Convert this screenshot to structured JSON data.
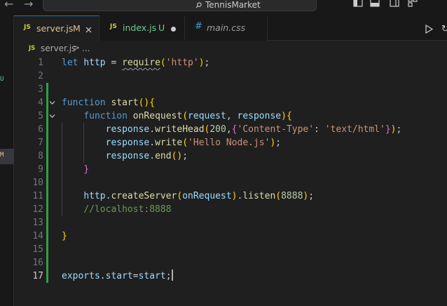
{
  "titlebar": {
    "search_title": "TennisMarket",
    "back_icon": "arrow-left-icon",
    "forward_icon": "arrow-right-icon"
  },
  "activitybar": {
    "badge_u": "U",
    "badge_m": "M"
  },
  "tabs": [
    {
      "icon": "JS",
      "name": "server.js",
      "status": "M",
      "active": true,
      "has_close": true
    },
    {
      "icon": "JS",
      "name": "index.js",
      "status": "U",
      "active": false,
      "has_dot": true
    },
    {
      "icon": "#",
      "name": "main.css",
      "status": "",
      "active": false,
      "italic": true
    }
  ],
  "breadcrumb": {
    "icon": "JS",
    "file": "server.js",
    "separator": ">",
    "more": "..."
  },
  "editor": {
    "current_line": 17,
    "lines": [
      {
        "n": "1",
        "text": "let http = require('http');"
      },
      {
        "n": "2",
        "text": ""
      },
      {
        "n": "3",
        "text": ""
      },
      {
        "n": "4",
        "text": "function start(){"
      },
      {
        "n": "5",
        "text": "    function onRequest(request, response){"
      },
      {
        "n": "6",
        "text": "        response.writeHead(200,{'Content-Type': 'text/html'});"
      },
      {
        "n": "7",
        "text": "        response.write('Hello Node.js');"
      },
      {
        "n": "8",
        "text": "        response.end();"
      },
      {
        "n": "9",
        "text": "    }"
      },
      {
        "n": "10",
        "text": ""
      },
      {
        "n": "11",
        "text": "    http.createServer(onRequest).listen(8888);"
      },
      {
        "n": "12",
        "text": "    //localhost:8888"
      },
      {
        "n": "13",
        "text": ""
      },
      {
        "n": "14",
        "text": "}"
      },
      {
        "n": "15",
        "text": ""
      },
      {
        "n": "16",
        "text": ""
      },
      {
        "n": "17",
        "text": "exports.start=start;"
      }
    ]
  },
  "colors": {
    "keyword": "#569cd6",
    "variable": "#9cdcfe",
    "function": "#dcdcaa",
    "string": "#ce9178",
    "number": "#b5cea8",
    "comment": "#6a9955",
    "accent": "#0078d4",
    "modified": "#e2c08d",
    "untracked": "#73c991"
  }
}
